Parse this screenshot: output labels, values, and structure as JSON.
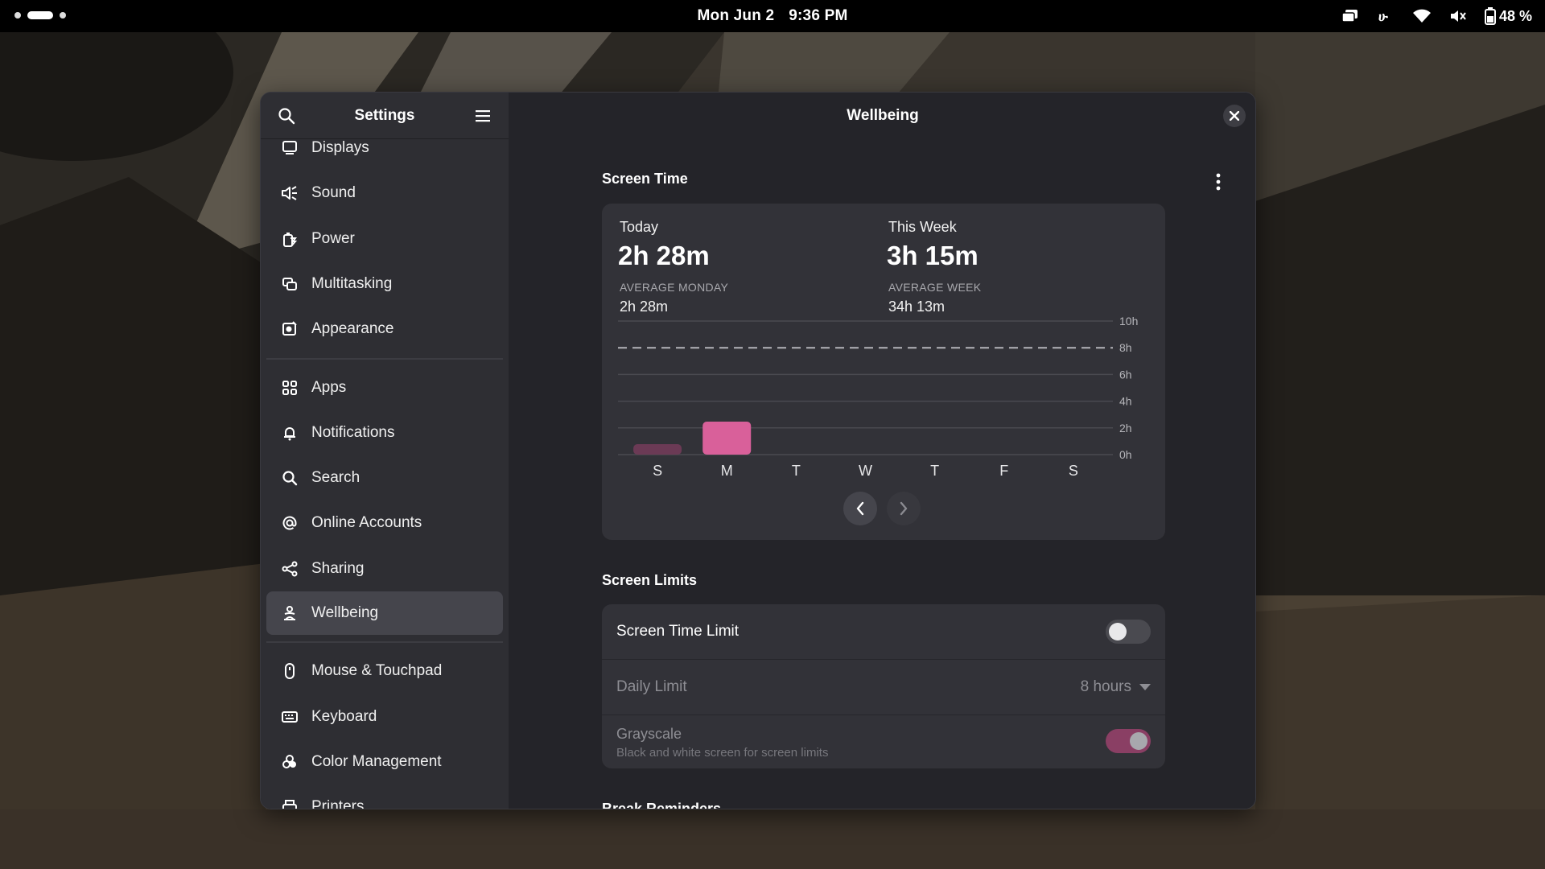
{
  "topbar": {
    "date": "Mon Jun 2",
    "time": "9:36 PM",
    "battery": "48 %"
  },
  "window": {
    "sidebar_title": "Settings",
    "content_title": "Wellbeing"
  },
  "sidebar": {
    "items": [
      {
        "label": "Displays",
        "icon": "display-icon"
      },
      {
        "label": "Sound",
        "icon": "speaker-icon"
      },
      {
        "label": "Power",
        "icon": "power-icon"
      },
      {
        "label": "Multitasking",
        "icon": "multitasking-icon"
      },
      {
        "label": "Appearance",
        "icon": "appearance-icon"
      },
      {
        "label": "Apps",
        "icon": "apps-grid-icon"
      },
      {
        "label": "Notifications",
        "icon": "bell-icon"
      },
      {
        "label": "Search",
        "icon": "search-icon"
      },
      {
        "label": "Online Accounts",
        "icon": "at-sign-icon"
      },
      {
        "label": "Sharing",
        "icon": "share-icon"
      },
      {
        "label": "Wellbeing",
        "icon": "wellbeing-icon",
        "active": true
      },
      {
        "label": "Mouse & Touchpad",
        "icon": "mouse-icon"
      },
      {
        "label": "Keyboard",
        "icon": "keyboard-icon"
      },
      {
        "label": "Color Management",
        "icon": "color-management-icon"
      },
      {
        "label": "Printers",
        "icon": "printer-icon"
      }
    ]
  },
  "screen_time": {
    "section_title": "Screen Time",
    "today_label": "Today",
    "today_value": "2h 28m",
    "avg_day_label": "AVERAGE MONDAY",
    "avg_day_value": "2h 28m",
    "week_label": "This Week",
    "week_value": "3h 15m",
    "avg_week_label": "AVERAGE WEEK",
    "avg_week_value": "34h 13m"
  },
  "chart_data": {
    "type": "bar",
    "categories": [
      "S",
      "M",
      "T",
      "W",
      "T",
      "F",
      "S"
    ],
    "values": [
      0.78,
      2.47,
      0,
      0,
      0,
      0,
      0
    ],
    "y_ticks": [
      "0h",
      "2h",
      "4h",
      "6h",
      "8h",
      "10h"
    ],
    "ylim": [
      0,
      10
    ],
    "limit_line": 8,
    "highlight_index": 1,
    "colors": {
      "highlight": "#d9609a",
      "normal": "#6b3a55",
      "grid": "#4a4a50"
    }
  },
  "screen_limits": {
    "section_title": "Screen Limits",
    "screen_time_limit_label": "Screen Time Limit",
    "screen_time_limit_on": false,
    "daily_limit_label": "Daily Limit",
    "daily_limit_value": "8 hours",
    "grayscale_label": "Grayscale",
    "grayscale_subtitle": "Black and white screen for screen limits",
    "grayscale_on": true
  },
  "break_reminders": {
    "section_title": "Break Reminders"
  },
  "colors": {
    "accent": "#d9609a",
    "topbar": "#000000",
    "sidebar": "#2e2e33",
    "content": "#242429",
    "card": "#323238"
  }
}
